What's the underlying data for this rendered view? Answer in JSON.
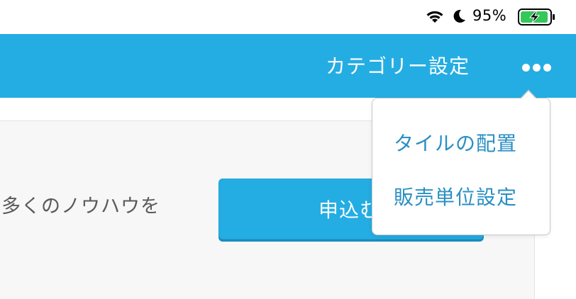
{
  "status_bar": {
    "wifi_icon": "wifi-icon",
    "moon_icon": "moon-icon",
    "battery_percent": "95%",
    "battery_icon": "battery-charging-icon",
    "battery_color": "#34c759"
  },
  "nav_bar": {
    "title": "カテゴリー設定",
    "more_icon": "more-dots-icon",
    "background_color": "#24ade3"
  },
  "content": {
    "card_text": "多くのノウハウを",
    "apply_button_label": "申込む"
  },
  "popover": {
    "items": [
      {
        "label": "タイルの配置"
      },
      {
        "label": "販売単位設定"
      }
    ],
    "item_color": "#2a8fc3"
  }
}
